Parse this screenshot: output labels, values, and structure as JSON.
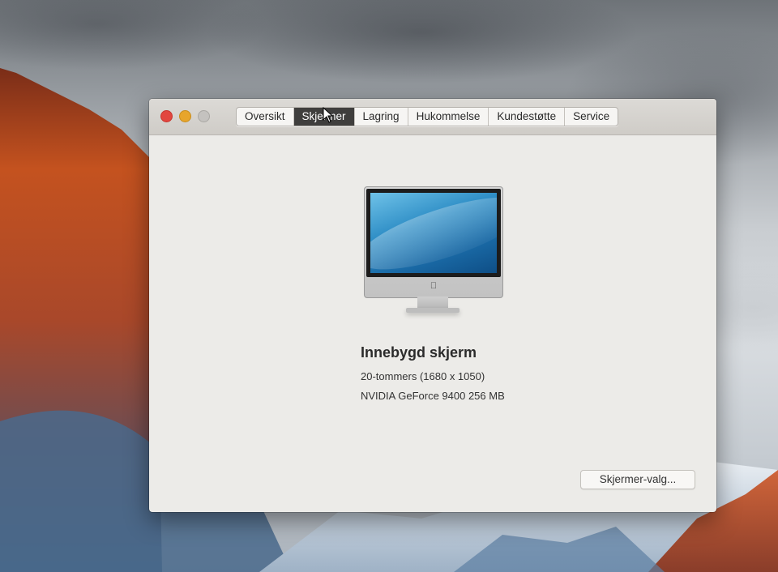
{
  "window": {
    "tabs": [
      {
        "label": "Oversikt",
        "active": false
      },
      {
        "label": "Skjermer",
        "active": true
      },
      {
        "label": "Lagring",
        "active": false
      },
      {
        "label": "Hukommelse",
        "active": false
      },
      {
        "label": "Kundestøtte",
        "active": false
      },
      {
        "label": "Service",
        "active": false
      }
    ]
  },
  "display": {
    "title": "Innebygd skjerm",
    "size": "20-tommers (1680 x 1050)",
    "graphics": "NVIDIA GeForce 9400 256 MB",
    "settings_button": "Skjermer-valg..."
  },
  "colors": {
    "close": "#e2463f",
    "minimize": "#e7a52b",
    "zoom": "#c4c2bf",
    "active_tab": "#3f3e3d"
  },
  "icons": {
    "apple_logo": "apple-logo-icon",
    "cursor": "mouse-pointer-icon"
  }
}
